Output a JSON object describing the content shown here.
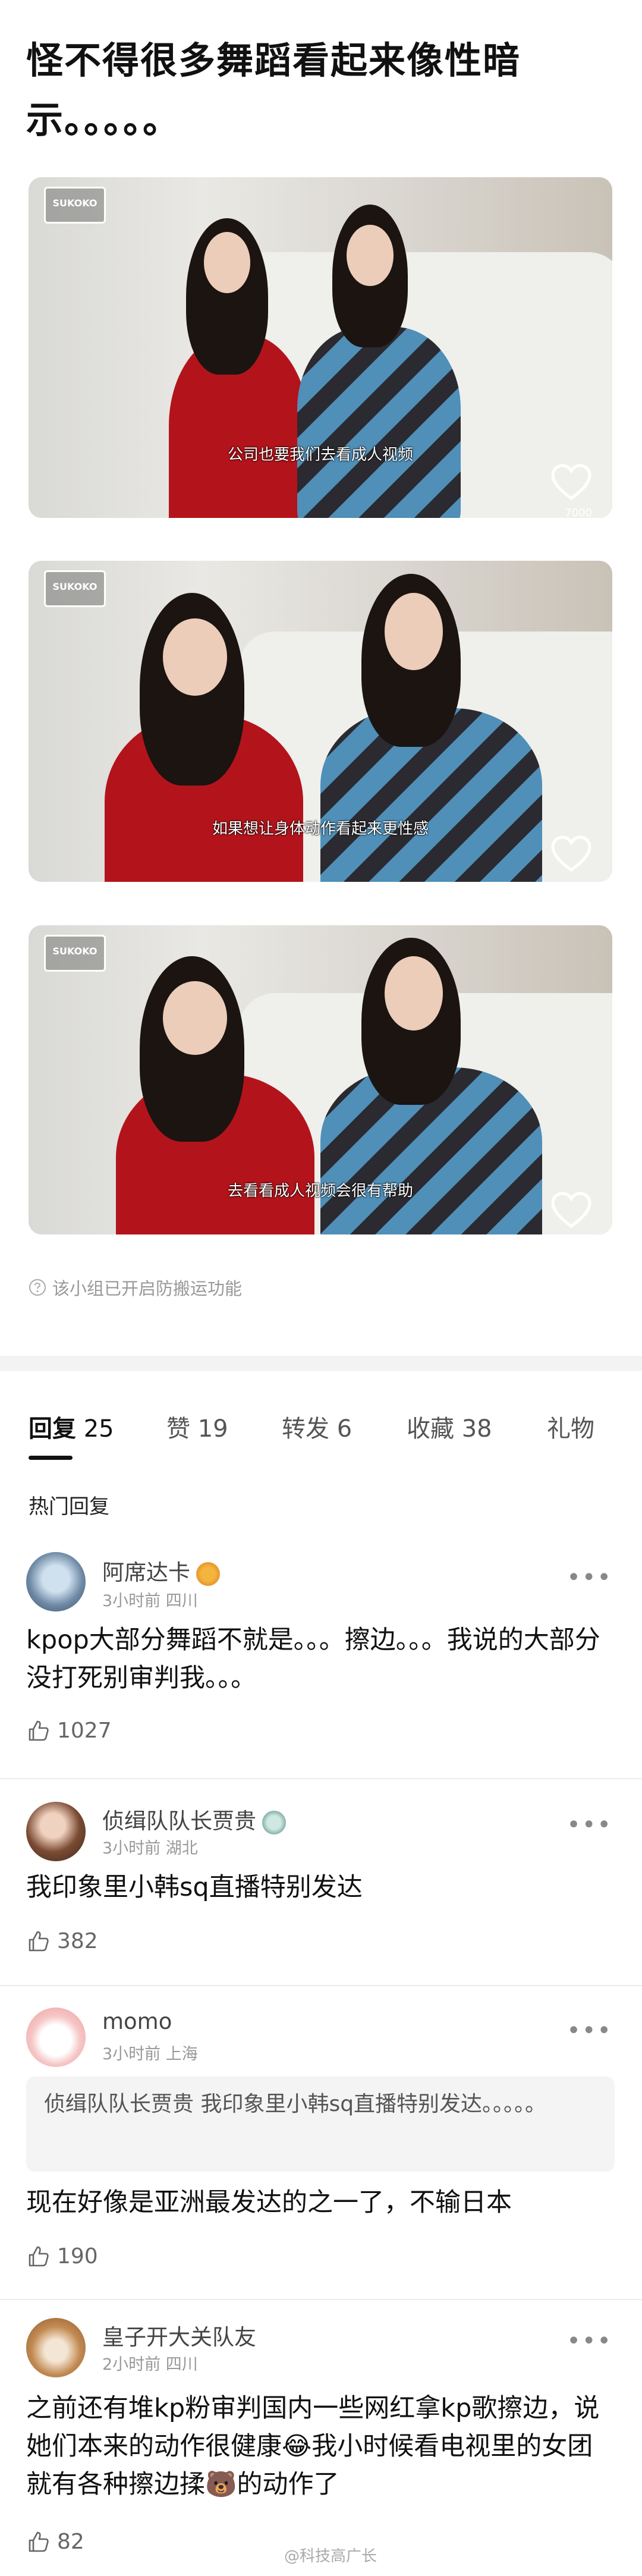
{
  "post": {
    "title": "怪不得很多舞蹈看起来像性暗示。。。。。",
    "notice": "该小组已开启防搬运功能"
  },
  "images": [
    {
      "logo": "SUKOKO",
      "caption": "公司也要我们去看成人视频",
      "corner_text": "7000"
    },
    {
      "logo": "SUKOKO",
      "caption": "如果想让身体动作看起来更性感",
      "corner_text": ""
    },
    {
      "logo": "SUKOKO",
      "caption": "去看看成人视频会很有帮助",
      "corner_text": ""
    }
  ],
  "tabs": [
    {
      "name": "回复",
      "count": "25"
    },
    {
      "name": "赞",
      "count": "19"
    },
    {
      "name": "转发",
      "count": "6"
    },
    {
      "name": "收藏",
      "count": "38"
    },
    {
      "name": "礼物",
      "count": ""
    }
  ],
  "section_title": "热门回复",
  "comments": [
    {
      "user": "阿席达卡",
      "meta": "3小时前 四川",
      "text": "kpop大部分舞蹈不就是。。。擦边。。。我说的大部分没打死别审判我。。。",
      "likes": "1027"
    },
    {
      "user": "侦缉队队长贾贵",
      "meta": "3小时前 湖北",
      "text": "我印象里小韩sq直播特别发达",
      "likes": "382"
    },
    {
      "user": "momo",
      "meta": "3小时前 上海",
      "quote": "侦缉队队长贾贵 我印象里小韩sq直播特别发达。。。。。",
      "text": "现在好像是亚洲最发达的之一了，不输日本",
      "likes": "190"
    },
    {
      "user": "皇子开大关队友",
      "meta": "2小时前 四川",
      "text": "之前还有堆kp粉审判国内一些网红拿kp歌擦边，说她们本来的动作很健康😂我小时候看电视里的女团就有各种擦边揉🐻的动作了",
      "likes": "82"
    }
  ],
  "more_label": "•••",
  "watermark": "@科技高广长"
}
